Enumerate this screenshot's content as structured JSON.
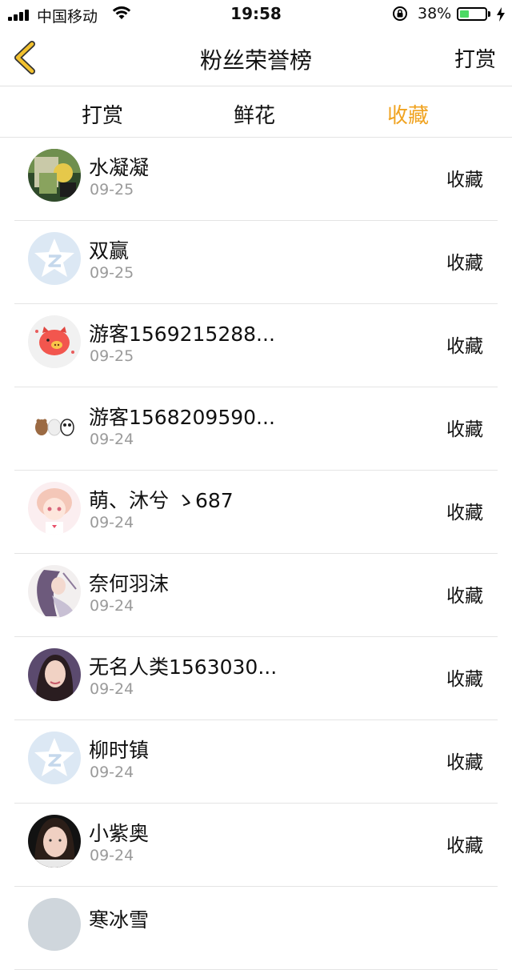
{
  "status_bar": {
    "carrier": "中国移动",
    "time": "19:58",
    "battery_percent": "38%",
    "battery_level": 0.38
  },
  "nav": {
    "title": "粉丝荣誉榜",
    "action_label": "打赏"
  },
  "tabs": [
    {
      "label": "打赏",
      "active": false
    },
    {
      "label": "鲜花",
      "active": false
    },
    {
      "label": "收藏",
      "active": true
    }
  ],
  "colors": {
    "accent": "#f0a321",
    "back_arrow_fill": "#f2c12e",
    "secondary_text": "#9a9a9a"
  },
  "fans": [
    {
      "name": "水凝凝",
      "date": "09-25",
      "tag": "收藏",
      "avatar": "photo-avatar"
    },
    {
      "name": "双赢",
      "date": "09-25",
      "tag": "收藏",
      "avatar": "qq-default-avatar"
    },
    {
      "name": "游客1569215288...",
      "date": "09-25",
      "tag": "收藏",
      "avatar": "pig-avatar"
    },
    {
      "name": "游客1568209590...",
      "date": "09-24",
      "tag": "收藏",
      "avatar": "bears-avatar"
    },
    {
      "name": "萌、沐兮 ゝ687",
      "date": "09-24",
      "tag": "收藏",
      "avatar": "anime-girl-avatar"
    },
    {
      "name": "奈何羽沫",
      "date": "09-24",
      "tag": "收藏",
      "avatar": "anime-girl-avatar"
    },
    {
      "name": "无名人类1563030...",
      "date": "09-24",
      "tag": "收藏",
      "avatar": "photo-avatar"
    },
    {
      "name": "柳时镇",
      "date": "09-24",
      "tag": "收藏",
      "avatar": "qq-default-avatar"
    },
    {
      "name": "小紫奥",
      "date": "09-24",
      "tag": "收藏",
      "avatar": "photo-avatar"
    },
    {
      "name": "寒冰雪",
      "date": "",
      "tag": "",
      "avatar": "photo-avatar"
    }
  ]
}
